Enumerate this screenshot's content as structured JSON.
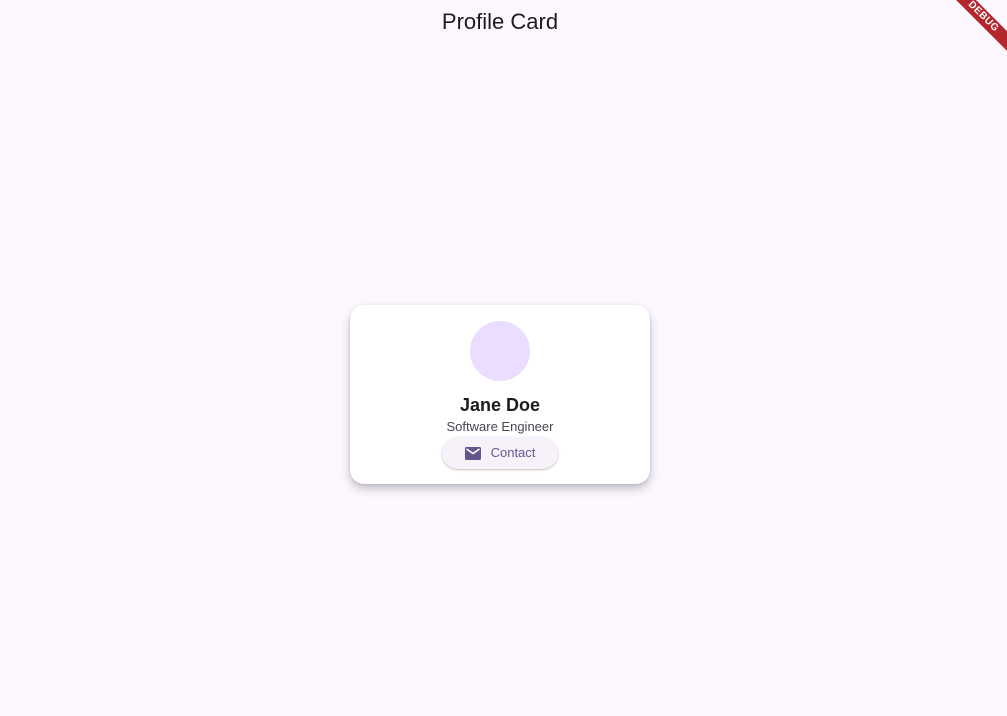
{
  "app_bar": {
    "title": "Profile Card"
  },
  "debug_banner": {
    "label": "DEBUG",
    "color": "#b3262d"
  },
  "profile": {
    "name": "Jane Doe",
    "role": "Software Engineer",
    "avatar_color": "#eaddff",
    "contact_button": {
      "label": "Contact",
      "icon": "mail-icon"
    }
  },
  "colors": {
    "background": "#fdf7ff",
    "card": "#ffffff",
    "accent": "#65558f"
  }
}
